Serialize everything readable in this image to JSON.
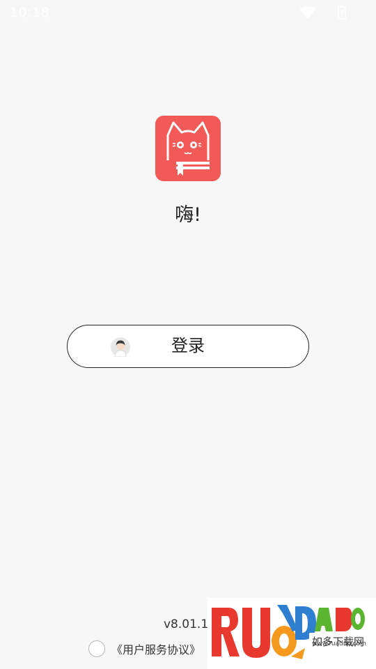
{
  "status_bar": {
    "time": "10:18"
  },
  "greeting": "嗨!",
  "login_button": {
    "label": "登录"
  },
  "footer": {
    "version": "v8.01.1",
    "terms_link": "《用户服务协议》"
  },
  "watermark": {
    "logo_text": "RUANDUO 如多下载网 www.ruaduo.com"
  },
  "colors": {
    "brand": "#f15a57",
    "background": "#f7f7f7"
  }
}
